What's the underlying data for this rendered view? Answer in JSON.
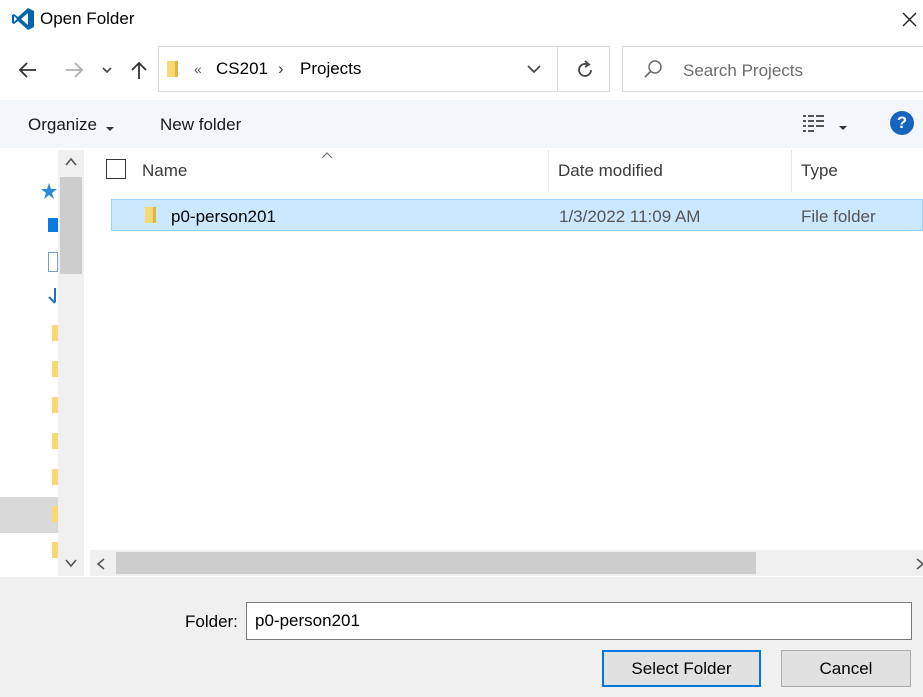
{
  "window": {
    "title": "Open Folder"
  },
  "address": {
    "overflow": "«",
    "crumbs": [
      "CS201",
      "Projects"
    ],
    "separator": "›"
  },
  "search": {
    "placeholder": "Search Projects"
  },
  "toolbar": {
    "organize_label": "Organize",
    "new_folder_label": "New folder",
    "help_label": "?"
  },
  "columns": {
    "name": "Name",
    "date_modified": "Date modified",
    "type": "Type"
  },
  "files": [
    {
      "name": "p0-person201",
      "date_modified": "1/3/2022 11:09 AM",
      "type": "File folder",
      "selected": true
    }
  ],
  "footer": {
    "folder_label": "Folder:",
    "folder_value": "p0-person201",
    "select_button": "Select Folder",
    "cancel_button": "Cancel"
  },
  "colors": {
    "accent": "#0078d7",
    "selection": "#cce8ff",
    "folder": "#f8d775",
    "help": "#1565c0",
    "vscode_blue": "#0065a9"
  },
  "icons": [
    "vscode-icon",
    "close-icon",
    "back-arrow-icon",
    "forward-arrow-icon",
    "recent-dropdown-icon",
    "up-arrow-icon",
    "folder-icon",
    "chevron-down-icon",
    "refresh-icon",
    "search-icon",
    "view-menu-icon",
    "help-icon",
    "sort-up-icon",
    "checkbox-icon",
    "quick-access-star-icon"
  ]
}
